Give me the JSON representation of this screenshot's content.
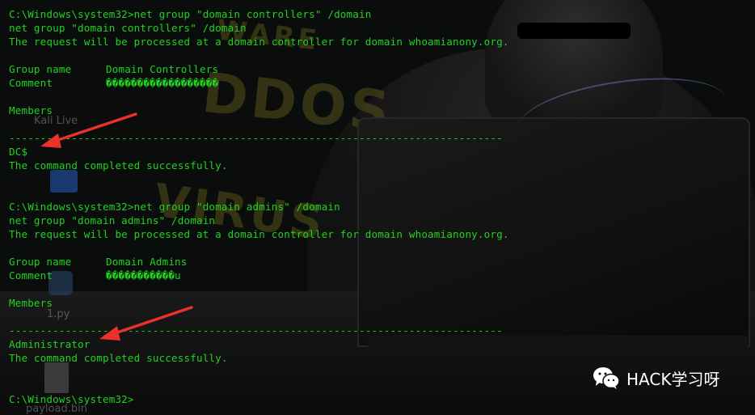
{
  "desktop_icons": {
    "kali": "Kali Live",
    "py": "1.py",
    "bin": "payload.bin"
  },
  "background_words": {
    "a": "DDOS",
    "b": "VIRUS",
    "c": "WARE"
  },
  "terminal": {
    "cmd1": "C:\\Windows\\system32>net group \"domain controllers\" /domain",
    "echo1": "net group \"domain controllers\" /domain",
    "req1": "The request will be processed at a domain controller for domain whoamianony.org.",
    "group_name_label1": "Group name",
    "group_name_value1": "Domain Controllers",
    "comment_label1": "Comment",
    "comment_value1": "������������������",
    "members_label1": "Members",
    "separator1": "-------------------------------------------------------------------------------",
    "member1": "DC$",
    "done1": "The command completed successfully.",
    "cmd2": "C:\\Windows\\system32>net group \"domain admins\" /domain",
    "echo2": "net group \"domain admins\" /domain",
    "req2": "The request will be processed at a domain controller for domain whoamianony.org.",
    "group_name_label2": "Group name",
    "group_name_value2": "Domain Admins",
    "comment_label2": "Comment",
    "comment_value2": "�����������u",
    "members_label2": "Members",
    "separator2": "-------------------------------------------------------------------------------",
    "member2": "Administrator",
    "done2": "The command completed successfully.",
    "prompt": "C:\\Windows\\system32>"
  },
  "annotations": {
    "arrow_color": "#e8322b"
  },
  "watermark": {
    "text": "HACK学习呀",
    "icon": "wechat-icon"
  },
  "colors": {
    "terminal_text": "#1fd31f"
  }
}
